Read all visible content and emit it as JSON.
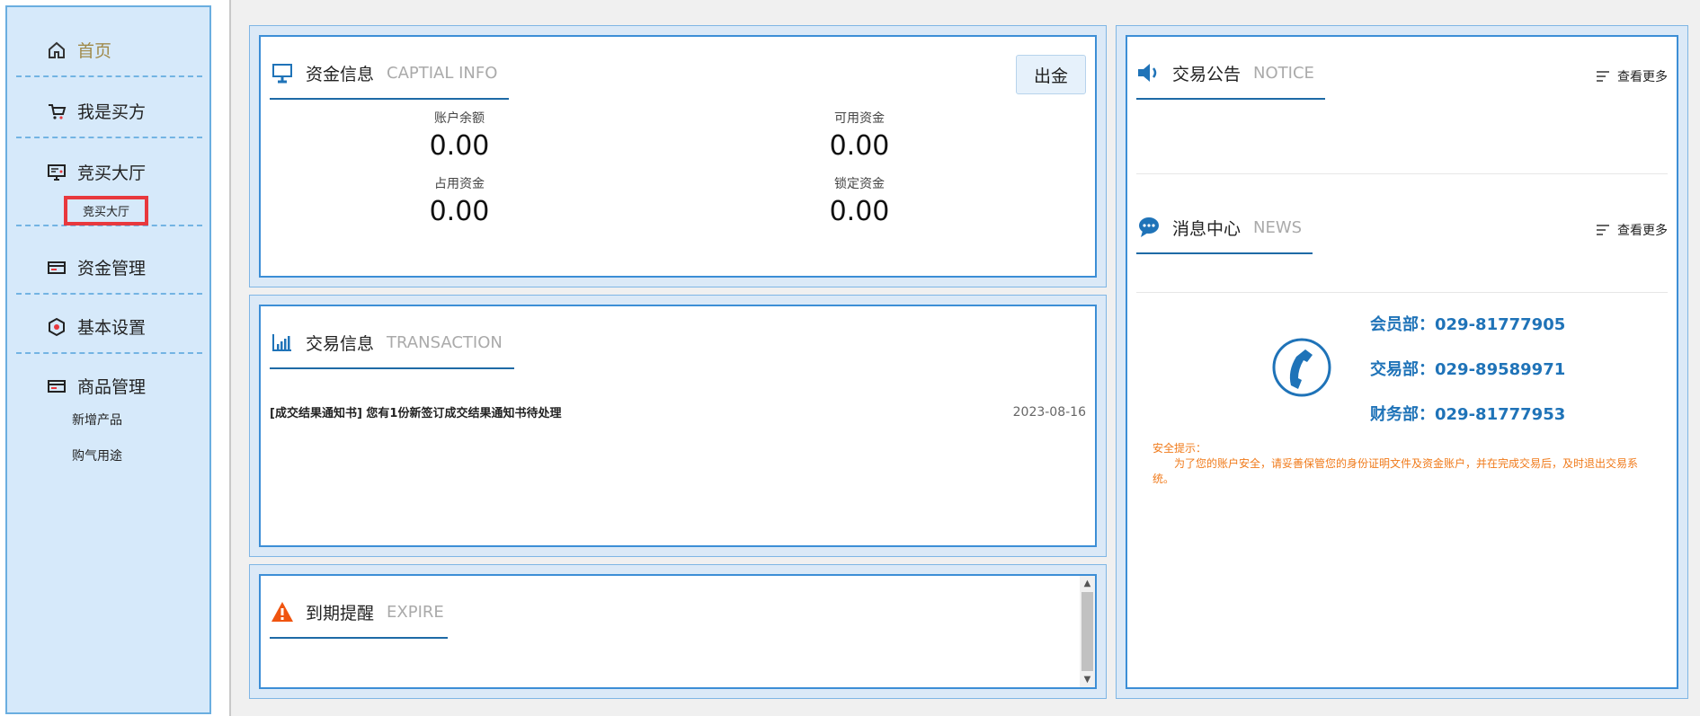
{
  "sidebar": {
    "home": "首页",
    "buyer": "我是买方",
    "hall": "竞买大厅",
    "hall_sub": "竞买大厅",
    "funds": "资金管理",
    "settings": "基本设置",
    "goods": "商品管理",
    "goods_sub1": "新增产品",
    "goods_sub2": "购气用途"
  },
  "capital": {
    "title": "资金信息",
    "title_en": "CAPTIAL INFO",
    "withdraw": "出金",
    "balance_label": "账户余额",
    "balance": "0.00",
    "available_label": "可用资金",
    "available": "0.00",
    "occupied_label": "占用资金",
    "occupied": "0.00",
    "locked_label": "锁定资金",
    "locked": "0.00"
  },
  "transaction": {
    "title": "交易信息",
    "title_en": "TRANSACTION",
    "items": [
      {
        "text": "[成交结果通知书] 您有1份新签订成交结果通知书待处理",
        "date": "2023-08-16"
      }
    ]
  },
  "expire": {
    "title": "到期提醒",
    "title_en": "EXPIRE"
  },
  "notice": {
    "title": "交易公告",
    "title_en": "NOTICE",
    "more": "查看更多"
  },
  "news": {
    "title": "消息中心",
    "title_en": "NEWS",
    "more": "查看更多"
  },
  "contacts": {
    "member": "会员部：029-81777905",
    "trade": "交易部：029-89589971",
    "finance": "财务部：029-81777953"
  },
  "safety": {
    "title": "安全提示：",
    "text": "为了您的账户安全，请妥善保管您的身份证明文件及资金账户，并在完成交易后，及时退出交易系统。"
  },
  "colors": {
    "accent": "#1f73b8",
    "warning": "#f07a1a",
    "sidebar_bg": "#d6e9fa",
    "highlight": "#e8383d"
  }
}
